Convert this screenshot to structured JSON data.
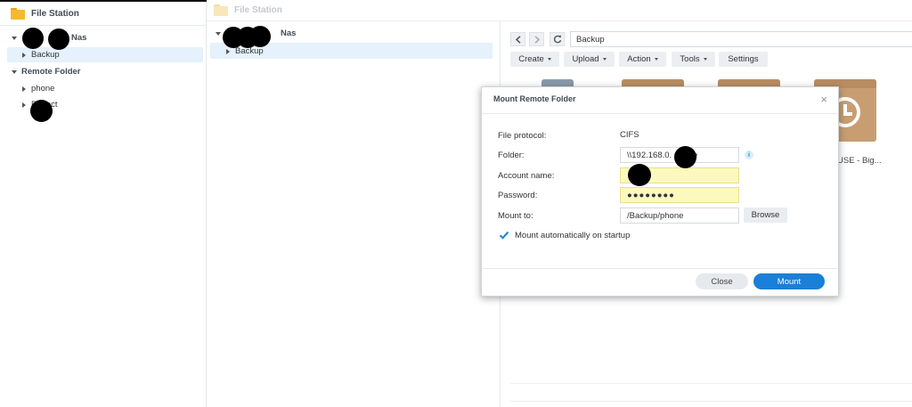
{
  "left_panel": {
    "title": "File Station",
    "nas_label": "Nas",
    "backup": "Backup",
    "remote_folder": "Remote Folder",
    "phone": "phone",
    "item3": "Project"
  },
  "background_window": {
    "title": "File Station",
    "nas_label": "Nas",
    "backup": "Backup",
    "path": "Backup",
    "toolbar": {
      "create": "Create",
      "upload": "Upload",
      "action": "Action",
      "tools": "Tools",
      "settings": "Settings"
    },
    "file_label": "USE - Big..."
  },
  "modal": {
    "title": "Mount Remote Folder",
    "close_glyph": "×",
    "file_protocol_label": "File protocol:",
    "file_protocol_value": "CIFS",
    "folder_label": "Folder:",
    "folder_value": "\\\\192.168.0.   phone",
    "info_glyph": "i",
    "account_label": "Account name:",
    "account_value": "",
    "password_label": "Password:",
    "password_value": "●●●●●●●●",
    "mount_to_label": "Mount to:",
    "mount_to_value": "/Backup/phone",
    "browse": "Browse",
    "auto_mount_label": "Mount automatically on startup",
    "auto_mount_checked": true,
    "close_button": "Close",
    "mount_button": "Mount"
  },
  "colors": {
    "accent": "#1a7fd8",
    "selection": "#e5f1fb",
    "input_highlight": "#fcf9bf",
    "folder": "#f5b92c",
    "archive_box": "#c89d72"
  },
  "icons": {
    "back": "chevron-left-icon",
    "forward": "chevron-right-icon",
    "refresh": "refresh-icon",
    "check": "checkmark-icon"
  }
}
